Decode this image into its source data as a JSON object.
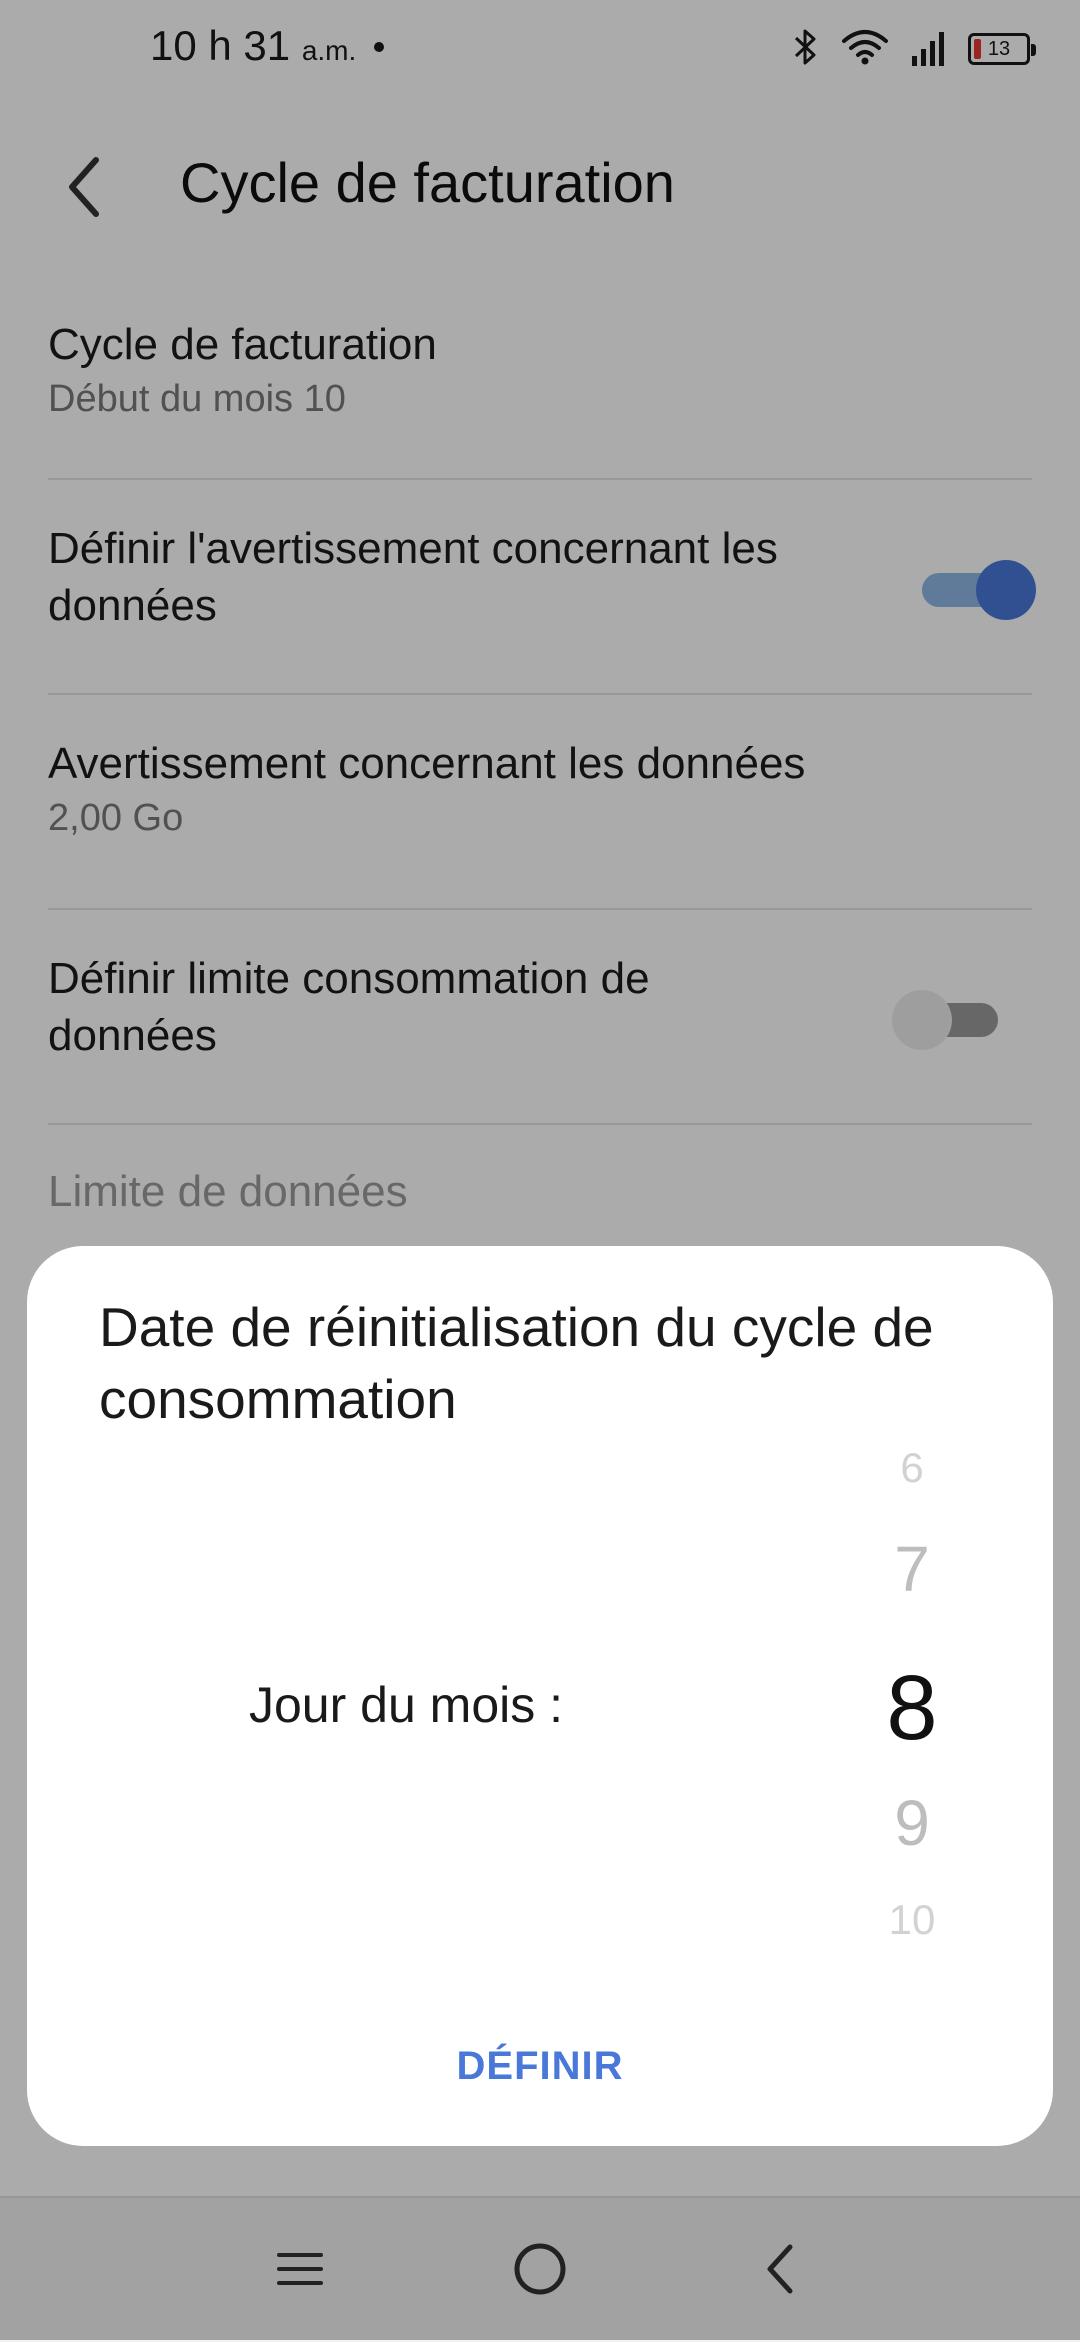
{
  "status_bar": {
    "time": "10 h 31",
    "ampm": "a.m.",
    "battery": "13"
  },
  "header": {
    "title": "Cycle de facturation"
  },
  "settings": {
    "billing_cycle": {
      "title": "Cycle de facturation",
      "subtitle": "Début du mois 10"
    },
    "set_warning": {
      "title": "Définir l'avertissement concernant les données",
      "enabled": true
    },
    "data_warning": {
      "title": "Avertissement concernant les données",
      "subtitle": "2,00 Go"
    },
    "set_limit": {
      "title": "Définir limite consommation de données",
      "enabled": false
    },
    "data_limit": {
      "title": "Limite de données"
    }
  },
  "dialog": {
    "title": "Date de réinitialisation du cycle de consommation",
    "picker_label": "Jour du mois :",
    "picker_values": [
      "6",
      "7",
      "8",
      "9",
      "10"
    ],
    "selected_value": "8",
    "button_label": "DÉFINIR"
  },
  "nav": {
    "icons": [
      "menu-icon",
      "home-icon",
      "back-icon"
    ]
  },
  "colors": {
    "accent": "#4a78d8",
    "toggle_track_on": "#8fb6e6",
    "scrim": "rgba(0,0,0,0.33)"
  }
}
